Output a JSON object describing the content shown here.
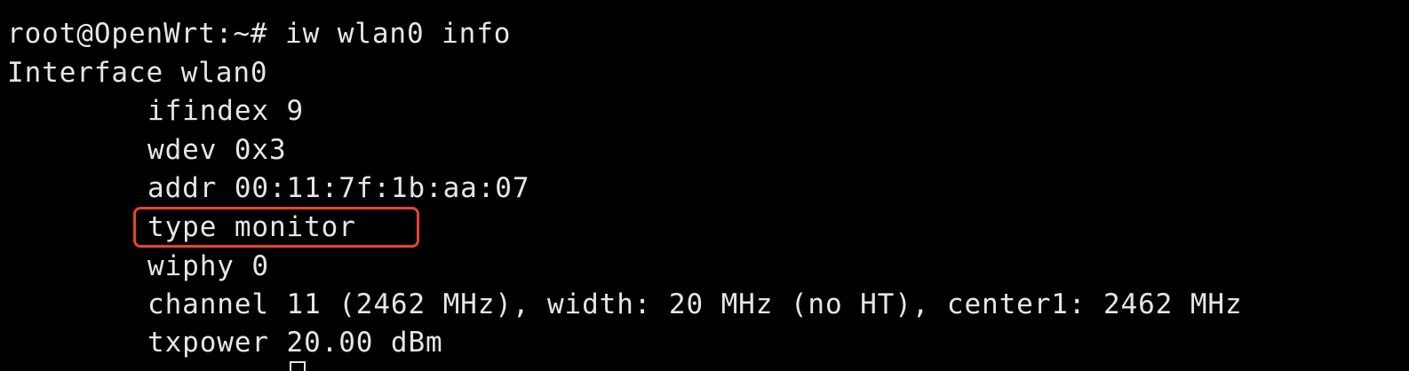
{
  "terminal": {
    "prompt_line": "root@OpenWrt:~# iw wlan0 info",
    "output_lines": [
      "Interface wlan0",
      "ifindex 9",
      "wdev 0x3",
      "addr 00:11:7f:1b:aa:07",
      "type monitor",
      "wiphy 0",
      "channel 11 (2462 MHz), width: 20 MHz (no HT), center1: 2462 MHz",
      "txpower 20.00 dBm"
    ],
    "highlighted_line": "type monitor",
    "colors": {
      "background": "#000000",
      "text": "#e6e6e6",
      "highlight_border": "#e8432f"
    }
  }
}
